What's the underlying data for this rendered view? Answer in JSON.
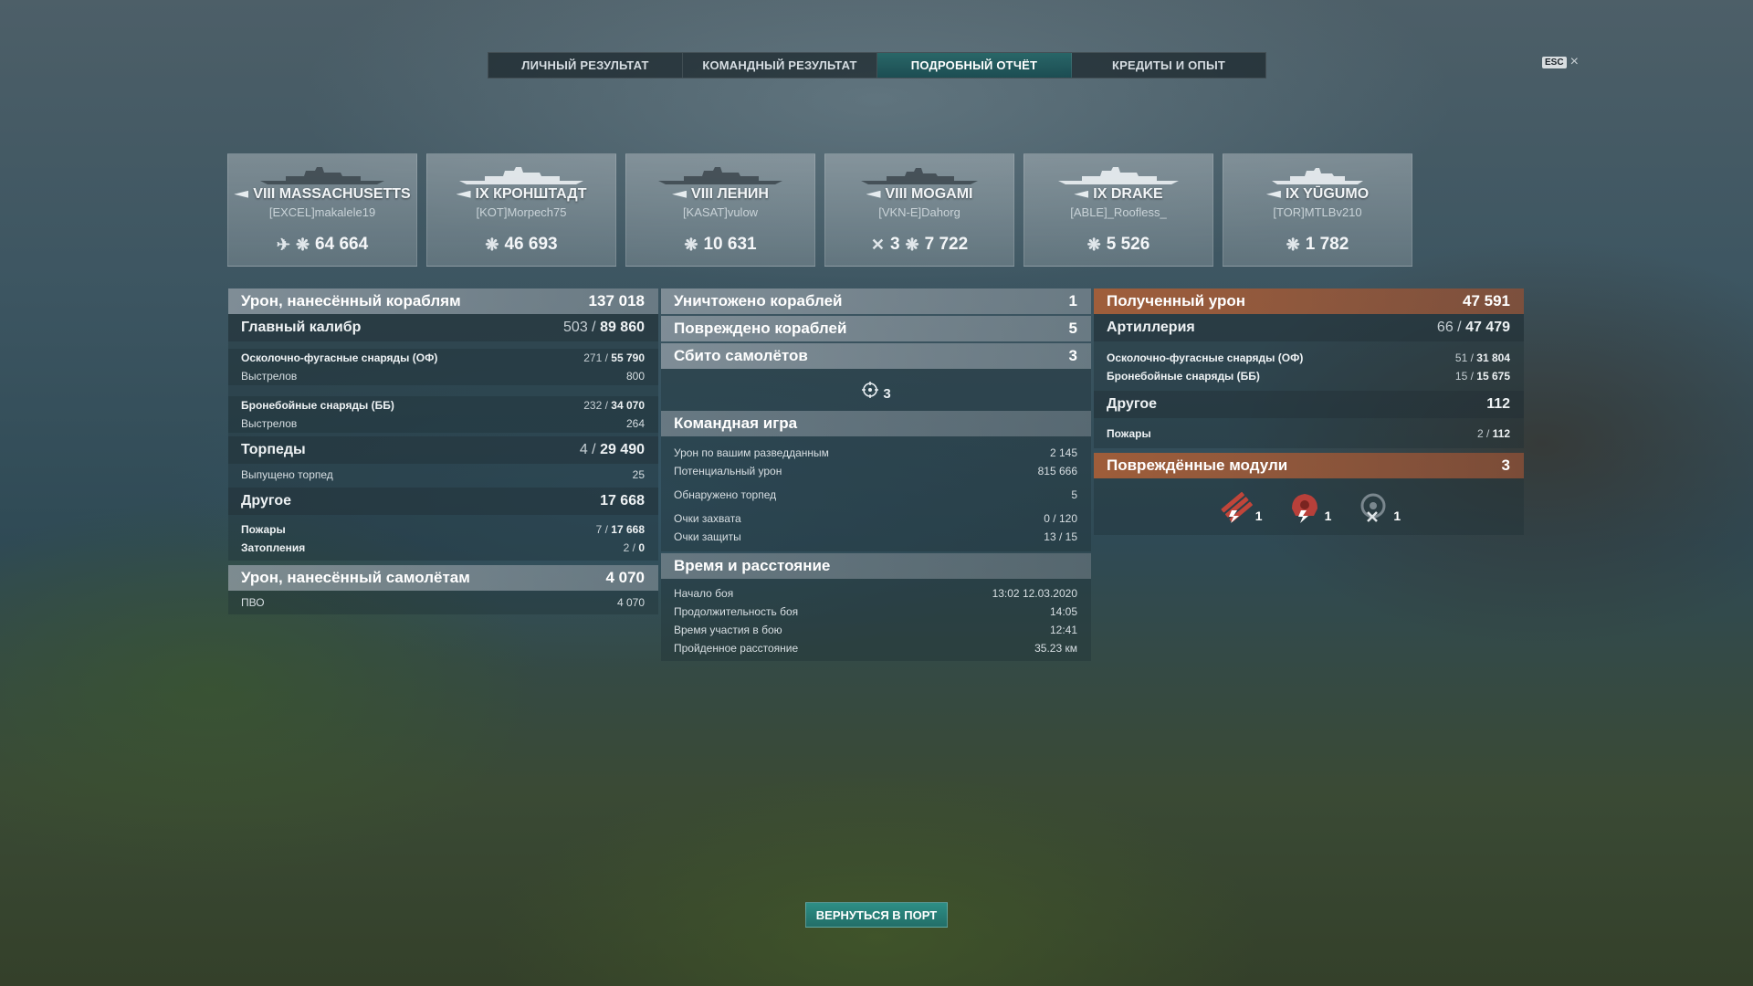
{
  "tabs": [
    {
      "label": "ЛИЧНЫЙ РЕЗУЛЬТАТ"
    },
    {
      "label": "КОМАНДНЫЙ РЕЗУЛЬТАТ"
    },
    {
      "label": "ПОДРОБНЫЙ ОТЧЁТ"
    },
    {
      "label": "КРЕДИТЫ И ОПЫТ"
    }
  ],
  "esc": {
    "key": "ESC",
    "close": "×"
  },
  "ships": [
    {
      "name": "VIII MASSACHUSETTS",
      "player": "[EXCEL]makalele19",
      "extra": "",
      "damage": "64 664"
    },
    {
      "name": "IX КРОНШТАДТ",
      "player": "[KOT]Morpech75",
      "extra": "",
      "damage": "46 693"
    },
    {
      "name": "VIII ЛЕНИН",
      "player": "[KASAT]vulow",
      "extra": "",
      "damage": "10 631"
    },
    {
      "name": "VIII MOGAMI",
      "player": "[VKN-E]Dahorg",
      "extra": "3",
      "damage": "7 722"
    },
    {
      "name": "IX DRAKE",
      "player": "[ABLE]_Roofless_",
      "extra": "",
      "damage": "5 526"
    },
    {
      "name": "IX YŪGUMO",
      "player": "[TOR]MTLBv210",
      "extra": "",
      "damage": "1 782"
    }
  ],
  "left": {
    "damage_ships": {
      "label": "Урон, нанесённый кораблям",
      "value": "137 018"
    },
    "main_caliber": {
      "label": "Главный калибр",
      "hits": "503",
      "value": "89 860"
    },
    "he": {
      "label": "Осколочно-фугасные снаряды (ОФ)",
      "hits": "271",
      "value": "55 790"
    },
    "he_shots": {
      "label": "Выстрелов",
      "value": "800"
    },
    "ap": {
      "label": "Бронебойные снаряды (ББ)",
      "hits": "232",
      "value": "34 070"
    },
    "ap_shots": {
      "label": "Выстрелов",
      "value": "264"
    },
    "torpedoes": {
      "label": "Торпеды",
      "hits": "4",
      "value": "29 490"
    },
    "torp_launched": {
      "label": "Выпущено торпед",
      "value": "25"
    },
    "other": {
      "label": "Другое",
      "value": "17 668"
    },
    "fires": {
      "label": "Пожары",
      "hits": "7",
      "value": "17 668"
    },
    "floods": {
      "label": "Затопления",
      "hits": "2",
      "value": "0"
    },
    "damage_planes": {
      "label": "Урон, нанесённый самолётам",
      "value": "4 070"
    },
    "aa": {
      "label": "ПВО",
      "value": "4 070"
    }
  },
  "middle": {
    "destroyed": {
      "label": "Уничтожено кораблей",
      "value": "1"
    },
    "damaged": {
      "label": "Повреждено кораблей",
      "value": "5"
    },
    "planes_down": {
      "label": "Сбито самолётов",
      "value": "3"
    },
    "planes_icon_count": "3",
    "teamplay": {
      "label": "Командная игра"
    },
    "spot_damage": {
      "label": "Урон по вашим разведданным",
      "value": "2 145"
    },
    "potential": {
      "label": "Потенциальный урон",
      "value": "815 666"
    },
    "torp_spotted": {
      "label": "Обнаружено торпед",
      "value": "5"
    },
    "capture": {
      "label": "Очки захвата",
      "value": "0 / 120"
    },
    "defense": {
      "label": "Очки защиты",
      "value": "13 / 15"
    },
    "time": {
      "label": "Время и расстояние"
    },
    "start": {
      "label": "Начало боя",
      "value": "13:02  12.03.2020"
    },
    "duration": {
      "label": "Продолжительность боя",
      "value": "14:05"
    },
    "participation": {
      "label": "Время участия в бою",
      "value": "12:41"
    },
    "distance": {
      "label": "Пройденное расстояние",
      "value": "35.23 км"
    }
  },
  "right": {
    "received": {
      "label": "Полученный урон",
      "value": "47 591"
    },
    "artillery": {
      "label": "Артиллерия",
      "hits": "66",
      "value": "47 479"
    },
    "he": {
      "label": "Осколочно-фугасные снаряды (ОФ)",
      "hits": "51",
      "value": "31 804"
    },
    "ap": {
      "label": "Бронебойные снаряды (ББ)",
      "hits": "15",
      "value": "15 675"
    },
    "other": {
      "label": "Другое",
      "value": "112"
    },
    "fires": {
      "label": "Пожары",
      "hits": "2",
      "value": "112"
    },
    "modules": {
      "label": "Повреждённые модули",
      "value": "3"
    },
    "module_counts": [
      "1",
      "1",
      "1"
    ]
  },
  "port_button": "ВЕРНУТЬСЯ В ПОРТ",
  "colors": {
    "accent": "#2e8f86",
    "received_header": "#aa5f37"
  }
}
